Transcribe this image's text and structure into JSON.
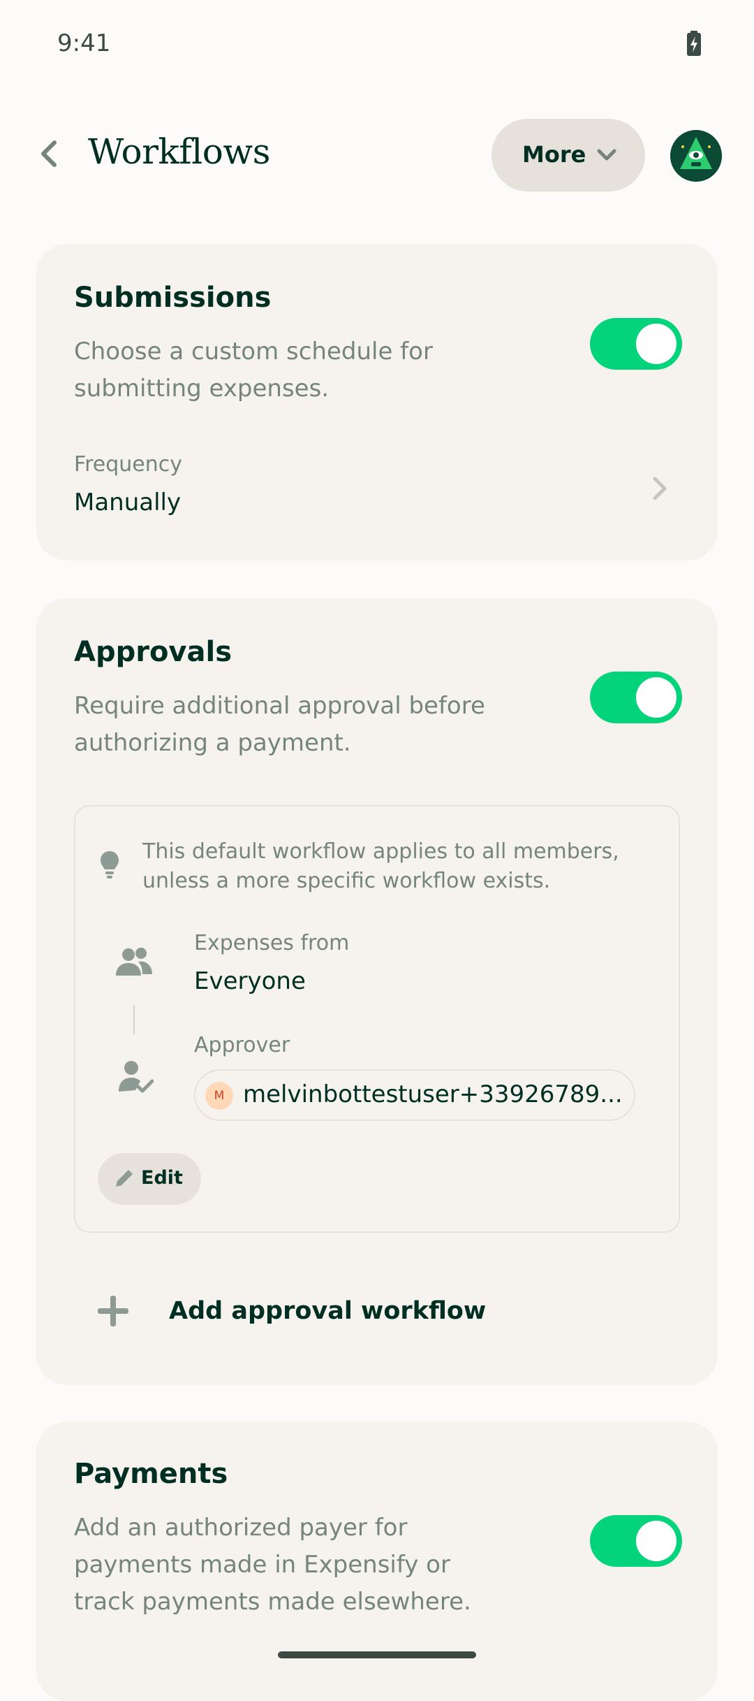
{
  "status_bar": {
    "time": "9:41"
  },
  "header": {
    "title": "Workflows",
    "more_label": "More"
  },
  "submissions": {
    "title": "Submissions",
    "description": "Choose a custom schedule for submitting expenses.",
    "enabled": true,
    "frequency_label": "Frequency",
    "frequency_value": "Manually"
  },
  "approvals": {
    "title": "Approvals",
    "description": "Require additional approval before authorizing a payment.",
    "enabled": true,
    "workflow": {
      "hint": "This default workflow applies to all members, unless a more specific workflow exists.",
      "expenses_from_label": "Expenses from",
      "expenses_from_value": "Everyone",
      "approver_label": "Approver",
      "approver_initial": "M",
      "approver_name": "melvinbottestuser+33926789...",
      "edit_label": "Edit"
    },
    "add_workflow_label": "Add approval workflow"
  },
  "payments": {
    "title": "Payments",
    "description": "Add an authorized payer for payments made in Expensify or track payments made elsewhere.",
    "enabled": true
  },
  "colors": {
    "accent_green": "#03D47C",
    "text_dark": "#002E22",
    "text_muted": "#76847E",
    "card_bg": "#F6F3EF",
    "page_bg": "#FCFBF9"
  }
}
